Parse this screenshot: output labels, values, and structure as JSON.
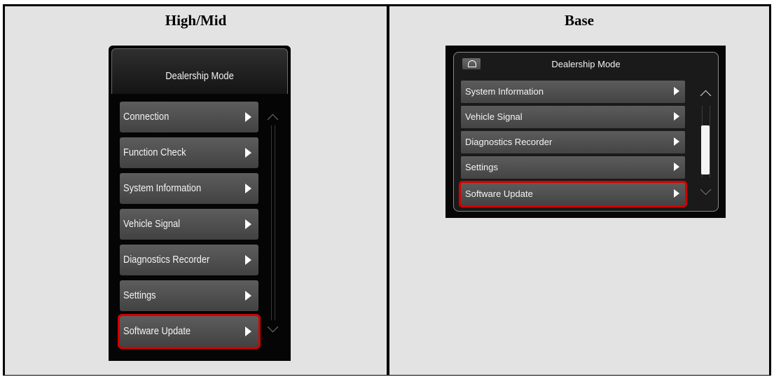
{
  "columns": {
    "left": {
      "heading": "High/Mid"
    },
    "right": {
      "heading": "Base"
    }
  },
  "high_mid_screen": {
    "title": "Dealership Mode",
    "items": [
      {
        "label": "Connection"
      },
      {
        "label": "Function Check"
      },
      {
        "label": "System Information"
      },
      {
        "label": "Vehicle Signal"
      },
      {
        "label": "Diagnostics Recorder"
      },
      {
        "label": "Settings"
      },
      {
        "label": "Software Update",
        "highlighted": true
      }
    ]
  },
  "base_screen": {
    "title": "Dealership Mode",
    "home_icon": "home-icon",
    "items": [
      {
        "label": "System Information"
      },
      {
        "label": "Vehicle Signal"
      },
      {
        "label": "Diagnostics Recorder"
      },
      {
        "label": "Settings"
      },
      {
        "label": "Software Update",
        "highlighted": true
      }
    ]
  },
  "colors": {
    "highlight": "#d40000",
    "panel_bg": "#e3e3e3",
    "button_bg": "#555555"
  }
}
